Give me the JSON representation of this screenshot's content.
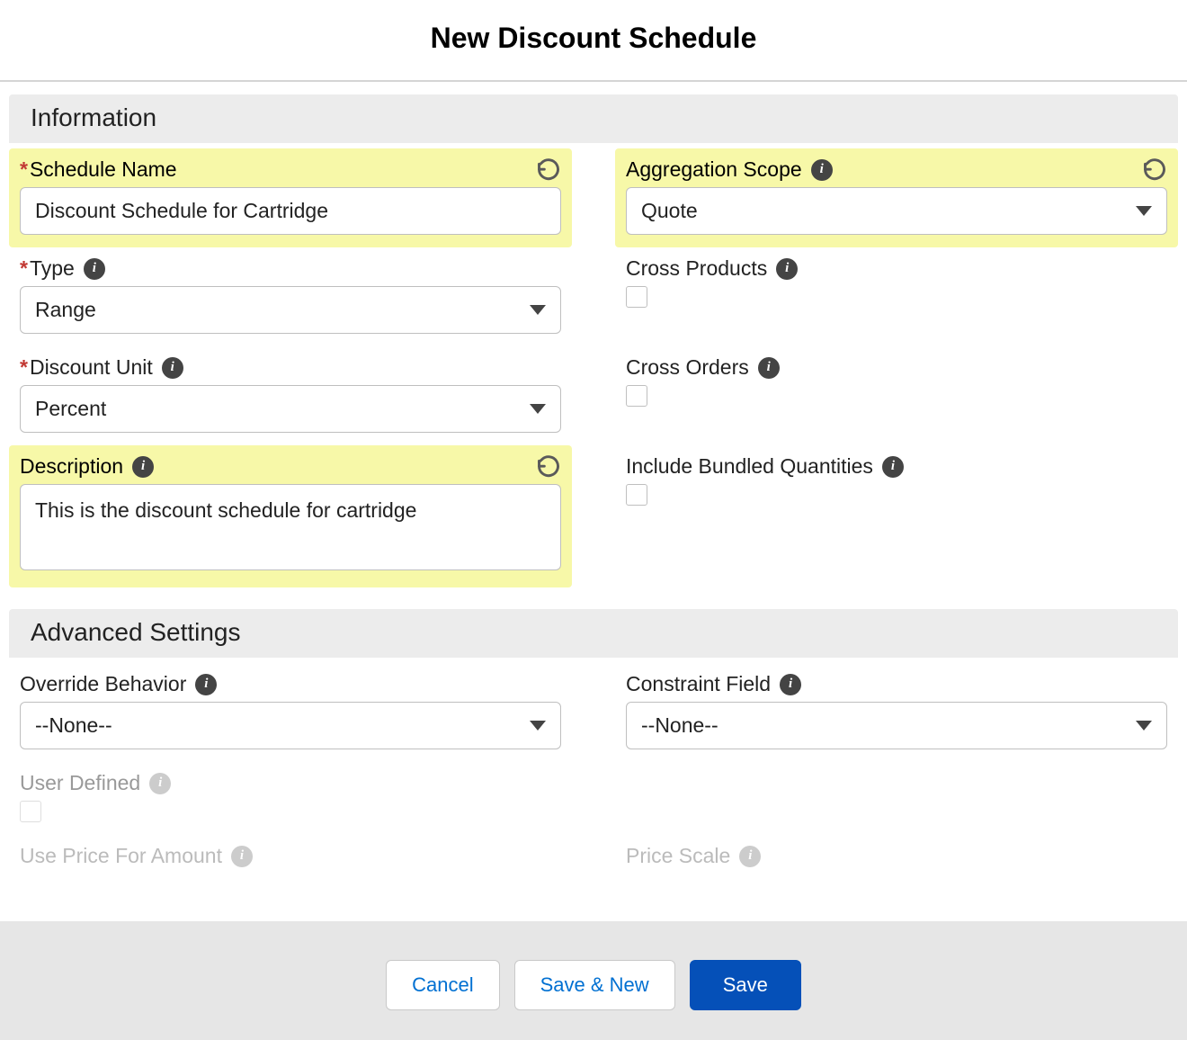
{
  "pageTitle": "New Discount Schedule",
  "sections": {
    "information": {
      "header": "Information",
      "fields": {
        "scheduleName": {
          "label": "Schedule Name",
          "value": "Discount Schedule for Cartridge"
        },
        "aggregationScope": {
          "label": "Aggregation Scope",
          "value": "Quote"
        },
        "type": {
          "label": "Type",
          "value": "Range"
        },
        "crossProducts": {
          "label": "Cross Products"
        },
        "discountUnit": {
          "label": "Discount Unit",
          "value": "Percent"
        },
        "crossOrders": {
          "label": "Cross Orders"
        },
        "description": {
          "label": "Description",
          "value": "This is the discount schedule for cartridge"
        },
        "includeBundled": {
          "label": "Include Bundled Quantities"
        }
      }
    },
    "advanced": {
      "header": "Advanced Settings",
      "fields": {
        "overrideBehavior": {
          "label": "Override Behavior",
          "value": "--None--"
        },
        "constraintField": {
          "label": "Constraint Field",
          "value": "--None--"
        },
        "userDefined": {
          "label": "User Defined"
        },
        "usePriceForAmount": {
          "label": "Use Price For Amount"
        },
        "priceScale": {
          "label": "Price Scale"
        }
      }
    }
  },
  "footer": {
    "cancel": "Cancel",
    "saveNew": "Save & New",
    "save": "Save"
  }
}
